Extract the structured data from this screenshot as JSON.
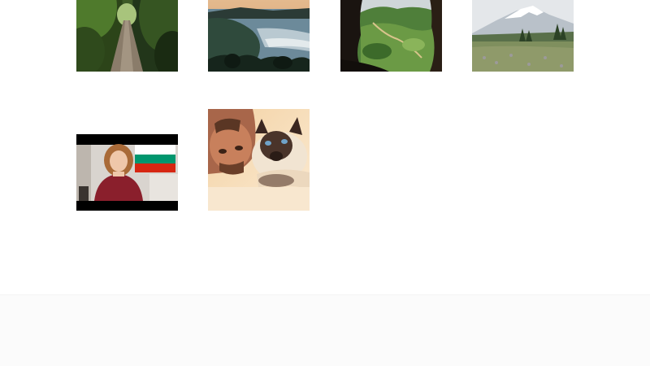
{
  "gallery": {
    "thumbnails": [
      {
        "subject": "forest-path",
        "kind": "photo"
      },
      {
        "subject": "coastal-sunset",
        "kind": "photo"
      },
      {
        "subject": "valley-from-cave",
        "kind": "photo"
      },
      {
        "subject": "snowy-mountain-meadow",
        "kind": "photo"
      },
      {
        "subject": "woman-with-bulgarian-flag",
        "kind": "video-frame"
      },
      {
        "subject": "man-with-siamese-cat",
        "kind": "photo"
      }
    ]
  },
  "colors": {
    "background": "#ffffff",
    "footer_background": "#fbfbfb"
  }
}
